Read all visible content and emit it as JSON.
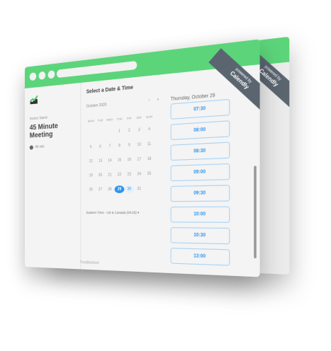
{
  "ribbon": {
    "top": "powered by",
    "brand": "Calendly"
  },
  "sidebar": {
    "organizer": "Invitee Name",
    "title": "45 Minute Meeting",
    "duration": "45 min",
    "troubleshoot": "Troubleshoot"
  },
  "main": {
    "heading": "Select a Date & Time",
    "month": "October 2020",
    "prev": "‹",
    "next": "›",
    "selected_date": "Thursday, October 29",
    "day_headers": [
      "MON",
      "TUE",
      "WED",
      "THU",
      "FRI",
      "SAT",
      "SUN"
    ],
    "timezone": "Eastern Time - US & Canada (09:25) ▾"
  },
  "calendar": {
    "selected": "29",
    "available": [
      "29",
      "30"
    ]
  },
  "times": [
    "07:30",
    "08:00",
    "08:30",
    "09:00",
    "09:30",
    "10:00",
    "10:30",
    "13:00"
  ],
  "colors": {
    "green": "#5cd57a",
    "blue": "#2b95f0"
  }
}
